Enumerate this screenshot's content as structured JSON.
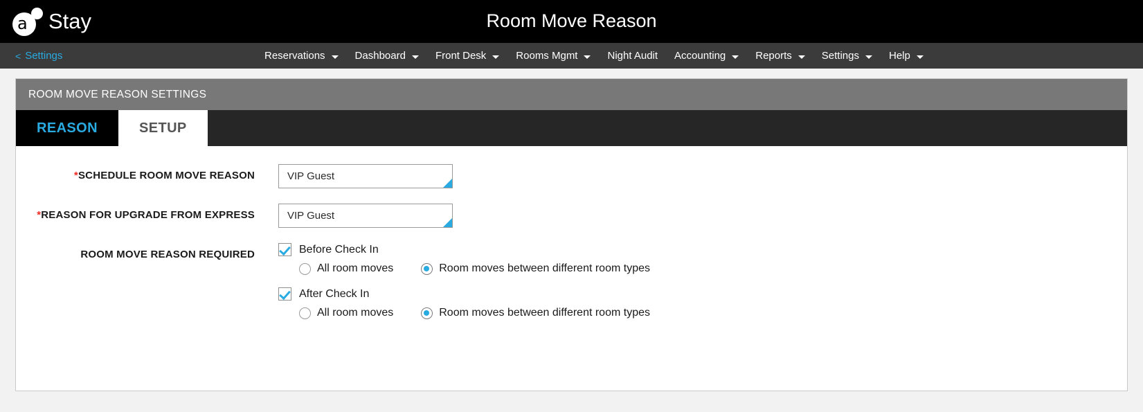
{
  "header": {
    "logo_letter": "a",
    "logo_text": "Stay",
    "page_title": "Room Move Reason"
  },
  "nav": {
    "back_chevron": "<",
    "back_label": "Settings",
    "items": [
      {
        "label": "Reservations",
        "caret": true
      },
      {
        "label": "Dashboard",
        "caret": true
      },
      {
        "label": "Front Desk",
        "caret": true
      },
      {
        "label": "Rooms Mgmt",
        "caret": true
      },
      {
        "label": "Night Audit",
        "caret": false
      },
      {
        "label": "Accounting",
        "caret": true
      },
      {
        "label": "Reports",
        "caret": true
      },
      {
        "label": "Settings",
        "caret": true
      },
      {
        "label": "Help",
        "caret": true
      }
    ]
  },
  "panel": {
    "title": "ROOM MOVE REASON SETTINGS",
    "tabs": [
      {
        "label": "REASON",
        "active": false
      },
      {
        "label": "SETUP",
        "active": true
      }
    ]
  },
  "form": {
    "schedule_reason": {
      "required_mark": "*",
      "label": "SCHEDULE ROOM MOVE REASON",
      "value": "VIP Guest"
    },
    "upgrade_reason": {
      "required_mark": "*",
      "label": "REASON FOR UPGRADE FROM EXPRESS",
      "value": "VIP Guest"
    },
    "required_group": {
      "label": "ROOM MOVE REASON REQUIRED",
      "before": {
        "checkbox_label": "Before Check In",
        "checked": true,
        "radio_all_label": "All room moves",
        "radio_all_selected": false,
        "radio_diff_label": "Room moves between different room types",
        "radio_diff_selected": true
      },
      "after": {
        "checkbox_label": "After Check In",
        "checked": true,
        "radio_all_label": "All room moves",
        "radio_all_selected": false,
        "radio_diff_label": "Room moves between different room types",
        "radio_diff_selected": true
      }
    }
  },
  "colors": {
    "accent": "#29abe2",
    "required": "#ee2b24",
    "header_bg": "#000000",
    "nav_bg": "#3b3b3b",
    "panel_header_bg": "#787878"
  }
}
